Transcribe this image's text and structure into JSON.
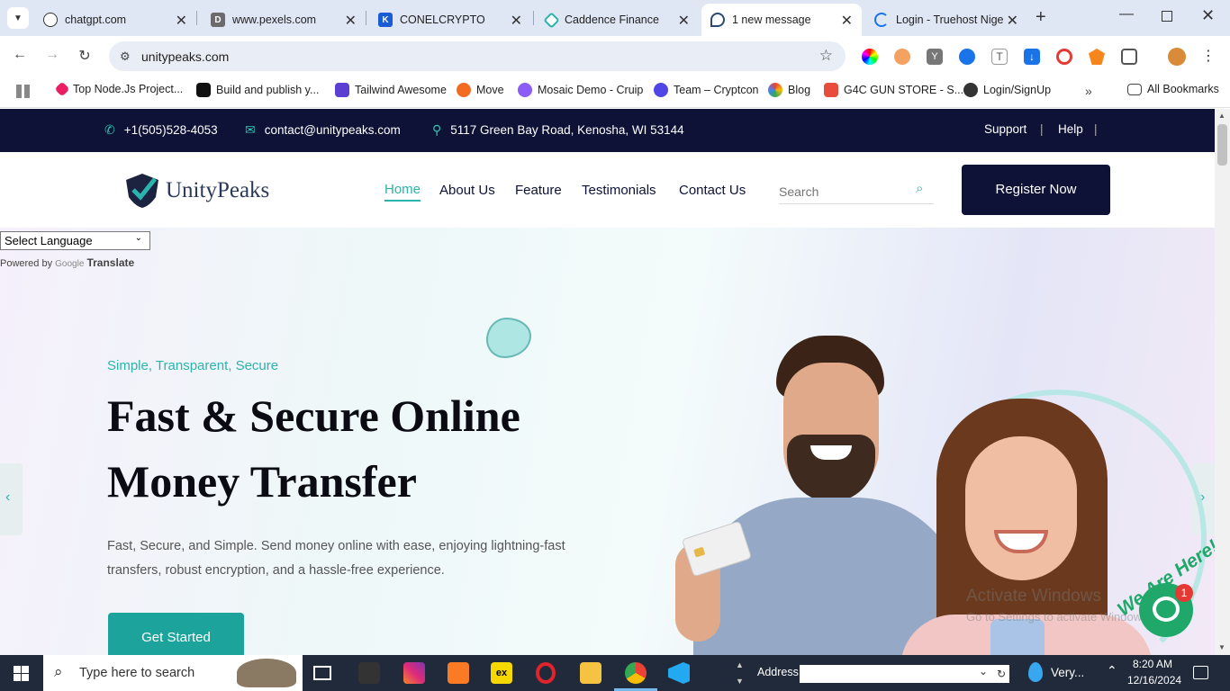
{
  "browser": {
    "tabs": [
      {
        "title": "chatgpt.com",
        "icon": "chatgpt-icon"
      },
      {
        "title": "www.pexels.com",
        "icon": "pexels-icon"
      },
      {
        "title": "CONELCRYPTO",
        "icon": "conelcrypto-icon"
      },
      {
        "title": "Caddence Finance",
        "icon": "caddence-icon"
      },
      {
        "title": "1 new message",
        "icon": "unitypeaks-icon"
      },
      {
        "title": "Login - Truehost Nige",
        "icon": "loading-icon"
      }
    ],
    "url": "unitypeaks.com",
    "bookmarks": [
      "Top Node.Js Project...",
      "Build and publish y...",
      "Tailwind Awesome",
      "Move",
      "Mosaic Demo - Cruip",
      "Team – Cryptcon",
      "Blog",
      "G4C GUN STORE - S...",
      "Login/SignUp"
    ],
    "all_bookmarks": "All Bookmarks"
  },
  "site": {
    "topbar": {
      "phone": "+1(505)528-4053",
      "email": "contact@unitypeaks.com",
      "address": "5117 Green Bay Road, Kenosha, WI 53144",
      "support": "Support",
      "help": "Help"
    },
    "brand": "UnityPeaks",
    "nav": [
      "Home",
      "About Us",
      "Feature",
      "Testimonials",
      "Contact Us"
    ],
    "search_placeholder": "Search",
    "register": "Register Now",
    "translate": {
      "select": "Select Language",
      "powered": "Powered by",
      "google": "Google",
      "translate": "Translate"
    },
    "hero": {
      "tagline": "Simple, Transparent, Secure",
      "title_line1": "Fast & Secure Online",
      "title_line2": "Money Transfer",
      "description_line1": "Fast, Secure, and Simple. Send money online with ease, enjoying lightning-fast",
      "description_line2": "transfers, robust encryption, and a hassle-free experience.",
      "cta": "Get Started"
    },
    "chat": {
      "badge": "1",
      "label": "We Are Here!"
    },
    "watermark": {
      "line1": "Activate Windows",
      "line2": "Go to Settings to activate Windows."
    }
  },
  "taskbar": {
    "search": "Type here to search",
    "address_label": "Address",
    "weather": "Very...",
    "time": "8:20 AM",
    "date": "12/16/2024"
  },
  "colors": {
    "navy": "#0d1236",
    "teal": "#2bb3ad",
    "tab_strip": "#dfe7f4"
  }
}
